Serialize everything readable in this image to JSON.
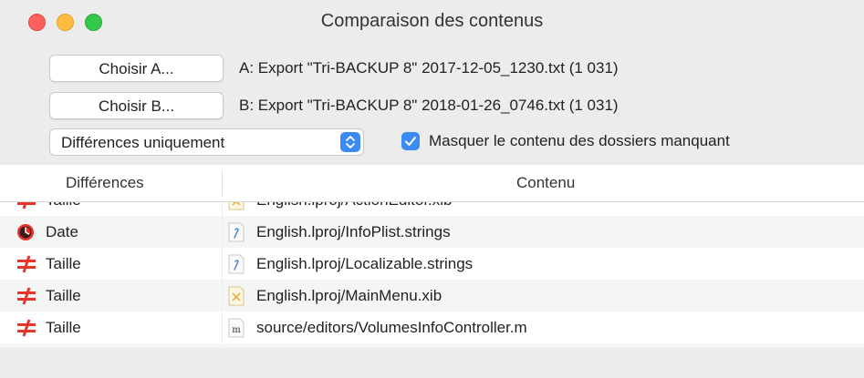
{
  "window": {
    "title": "Comparaison des contenus"
  },
  "controls": {
    "choose_a_label": "Choisir A...",
    "choose_b_label": "Choisir B...",
    "path_a": "A: Export \"Tri-BACKUP 8\" 2017-12-05_1230.txt (1 031)",
    "path_b": "B: Export \"Tri-BACKUP 8\" 2018-01-26_0746.txt (1 031)",
    "filter_selected": "Différences uniquement",
    "hide_missing_checked": true,
    "hide_missing_label": "Masquer le contenu des dossiers manquant"
  },
  "table": {
    "columns": [
      "Différences",
      "Contenu"
    ],
    "rows": [
      {
        "status": "Taille",
        "status_icon": "not-equal-icon",
        "icon": "xib-file-icon",
        "name": "English.lproj/ActionEditor.xib"
      },
      {
        "status": "Date",
        "status_icon": "clock-icon",
        "icon": "strings-file-icon",
        "name": "English.lproj/InfoPlist.strings"
      },
      {
        "status": "Taille",
        "status_icon": "not-equal-icon",
        "icon": "strings-file-icon",
        "name": "English.lproj/Localizable.strings"
      },
      {
        "status": "Taille",
        "status_icon": "not-equal-icon",
        "icon": "xib-file-icon",
        "name": "English.lproj/MainMenu.xib"
      },
      {
        "status": "Taille",
        "status_icon": "not-equal-icon",
        "icon": "m-file-icon",
        "name": "source/editors/VolumesInfoController.m"
      }
    ]
  },
  "colors": {
    "accent": "#3b8bf5",
    "diff_red": "#e8352b"
  }
}
